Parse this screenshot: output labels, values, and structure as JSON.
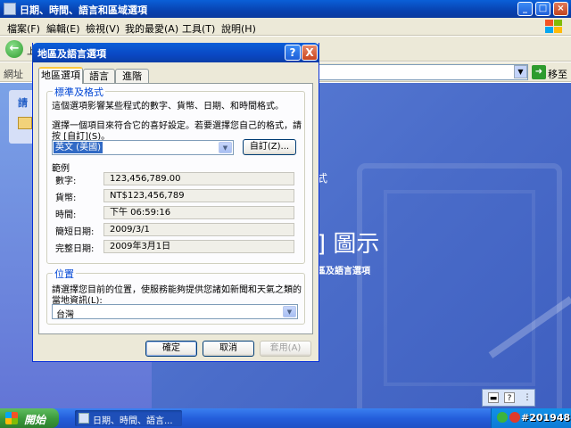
{
  "window": {
    "title": "日期、時間、語言和區域選項",
    "menu": [
      "檔案(F)",
      "編輯(E)",
      "檢視(V)",
      "我的最愛(A)",
      "工具(T)",
      "說明(H)"
    ],
    "back_label": "上",
    "address_label": "網址",
    "go_label": "移至",
    "left_title": "請",
    "main_text1": "",
    "main_text2": "] 圖示",
    "main_text3": "區及語言選項",
    "main_char": "式"
  },
  "dialog": {
    "title": "地區及語言選項",
    "help_btn": "?",
    "close_btn": "X",
    "tabs": [
      "地區選項",
      "語言",
      "進階"
    ],
    "standards": {
      "group_title": "標準及格式",
      "description": "這個選項影響某些程式的數字、貨幣、日期、和時間格式。",
      "instruction_line1": "選擇一個項目來符合它的喜好設定。若要選擇您自己的格式，請",
      "instruction_line2": "按 [自訂](S)。",
      "selected_format": "英文 (美國)",
      "customize_button": "自訂(Z)...",
      "samples_heading": "範例",
      "samples": [
        {
          "label": "數字:",
          "value": "123,456,789.00"
        },
        {
          "label": "貨幣:",
          "value": "NT$123,456,789"
        },
        {
          "label": "時間:",
          "value": "下午 06:59:16"
        },
        {
          "label": "簡短日期:",
          "value": "2009/3/1"
        },
        {
          "label": "完整日期:",
          "value": "2009年3月1日"
        }
      ]
    },
    "location": {
      "group_title": "位置",
      "description_line1": "請選擇您目前的位置，使服務能夠提供您諸如新聞和天氣之類的",
      "description_line2": "當地資訊(L):",
      "selected": "台灣"
    },
    "buttons": {
      "ok": "確定",
      "cancel": "取消",
      "apply": "套用(A)"
    }
  },
  "taskbar": {
    "start_label": "開始",
    "task_label": "日期、時間、語言...",
    "stamp": "#201948"
  },
  "colors": {
    "titlebar": "#0a48c4",
    "dialog_bg": "#ece9d8",
    "accent_blue": "#0046d5",
    "selection": "#316ac5"
  }
}
